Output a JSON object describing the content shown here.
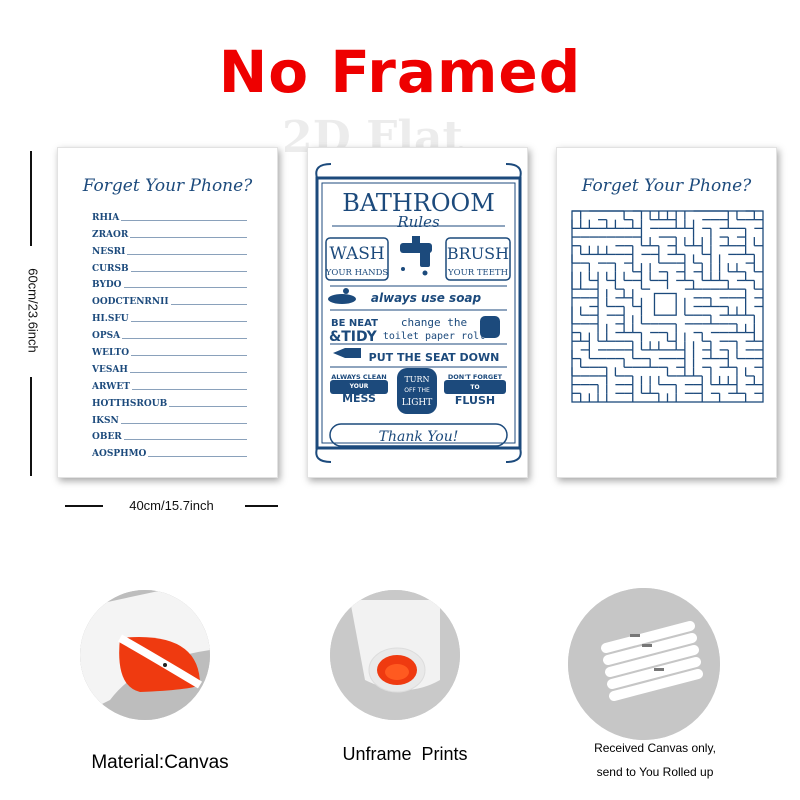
{
  "headline": "No Framed",
  "watermark": "2D Flat",
  "dimensions": {
    "height": "60cm/23.6inch",
    "width": "40cm/15.7inch"
  },
  "poster_word": {
    "title": "Forget Your Phone?",
    "words": [
      "RHIA",
      "ZRAOR",
      "NESRI",
      "CURSB",
      "BYDO",
      "OODCTENRNII",
      "HI.SFU",
      "OPSA",
      "WELTO",
      "VESAH",
      "ARWET",
      "HOTTHSROUB",
      "IKSN",
      "OBER",
      "AOSPHMO"
    ]
  },
  "poster_rules": {
    "title": "BATHROOM",
    "subtitle": "Rules",
    "wash": "WASH",
    "your_hands": "YOUR HANDS",
    "brush": "BRUSH",
    "your_teeth": "YOUR TEETH",
    "soap": "always use soap",
    "be_neat": "BE NEAT",
    "tidy": "&TIDY",
    "change": "change the",
    "toilet_roll": "toilet paper roll",
    "seat": "PUT THE SEAT DOWN",
    "always_clean": "ALWAYS CLEAN",
    "your": "YOUR",
    "mess": "MESS",
    "turn_off": "TURN",
    "off_the": "OFF THE",
    "light": "LIGHT",
    "dont_forget": "DON'T FORGET",
    "to": "TO",
    "flush": "FLUSH",
    "thanks": "Thank You!"
  },
  "poster_maze": {
    "title": "Forget Your Phone?"
  },
  "features": [
    {
      "caption": "Material:Canvas"
    },
    {
      "caption": "Unframe  Prints"
    },
    {
      "caption_line1": "Received Canvas only,",
      "caption_line2": "send to You Rolled up"
    }
  ],
  "colors": {
    "headline": "#ee0000",
    "ink": "#1c4a7c",
    "canvas_back": "#ef3a10"
  }
}
